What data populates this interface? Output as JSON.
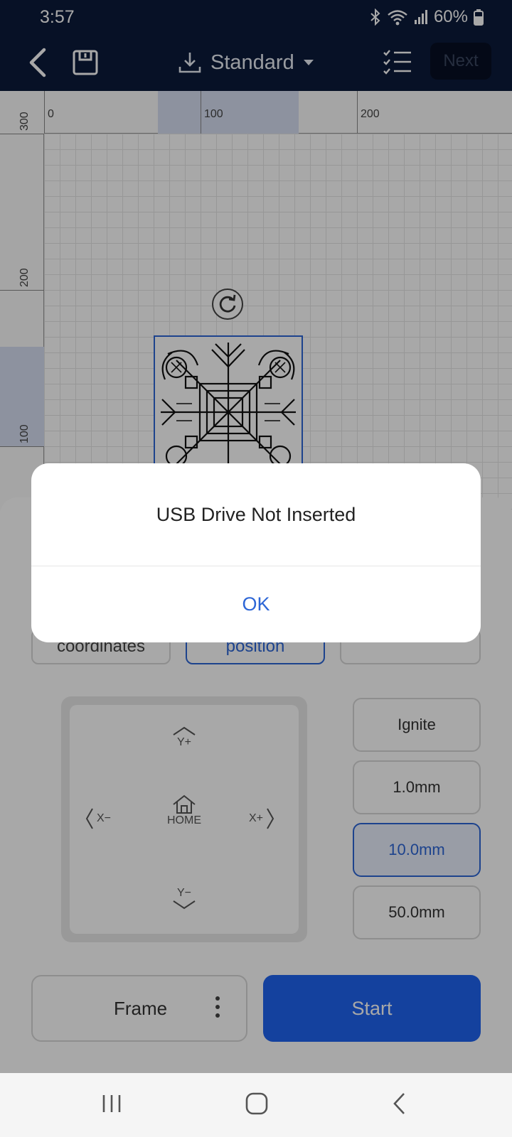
{
  "status_bar": {
    "time": "3:57",
    "battery": "60%",
    "icons": [
      "bluetooth-icon",
      "wifi-icon",
      "signal-icon",
      "battery-icon"
    ]
  },
  "app_bar": {
    "back_icon": "chevron-left-icon",
    "save_icon": "save-icon",
    "mode_label": "Standard",
    "mode_icon": "download-icon",
    "dropdown_icon": "caret-down-icon",
    "list_icon": "checklist-icon",
    "next_label": "Next"
  },
  "canvas": {
    "ruler_top_labels": [
      "0",
      "100",
      "200"
    ],
    "ruler_left_labels": [
      "300",
      "200",
      "100"
    ],
    "rotate_icon": "rotate-icon"
  },
  "panel": {
    "options": [
      {
        "label": "coordinates",
        "selected": false
      },
      {
        "label": "position",
        "selected": true
      },
      {
        "label": "",
        "selected": false
      }
    ],
    "jog": {
      "y_plus": "Y+",
      "y_minus": "Y−",
      "x_minus": "X−",
      "x_plus": "X+",
      "home": "HOME"
    },
    "side_buttons": [
      {
        "label": "Ignite",
        "selected": false
      },
      {
        "label": "1.0mm",
        "selected": false
      },
      {
        "label": "10.0mm",
        "selected": true
      },
      {
        "label": "50.0mm",
        "selected": false
      }
    ],
    "frame_label": "Frame",
    "start_label": "Start"
  },
  "dialog": {
    "message": "USB Drive Not Inserted",
    "ok_label": "OK"
  },
  "nav_bar": {
    "icons": [
      "recent-apps-icon",
      "home-icon",
      "back-icon"
    ]
  },
  "colors": {
    "brand_dark": "#0c1a3a",
    "accent": "#2d66d6",
    "start": "#1f63f0"
  }
}
